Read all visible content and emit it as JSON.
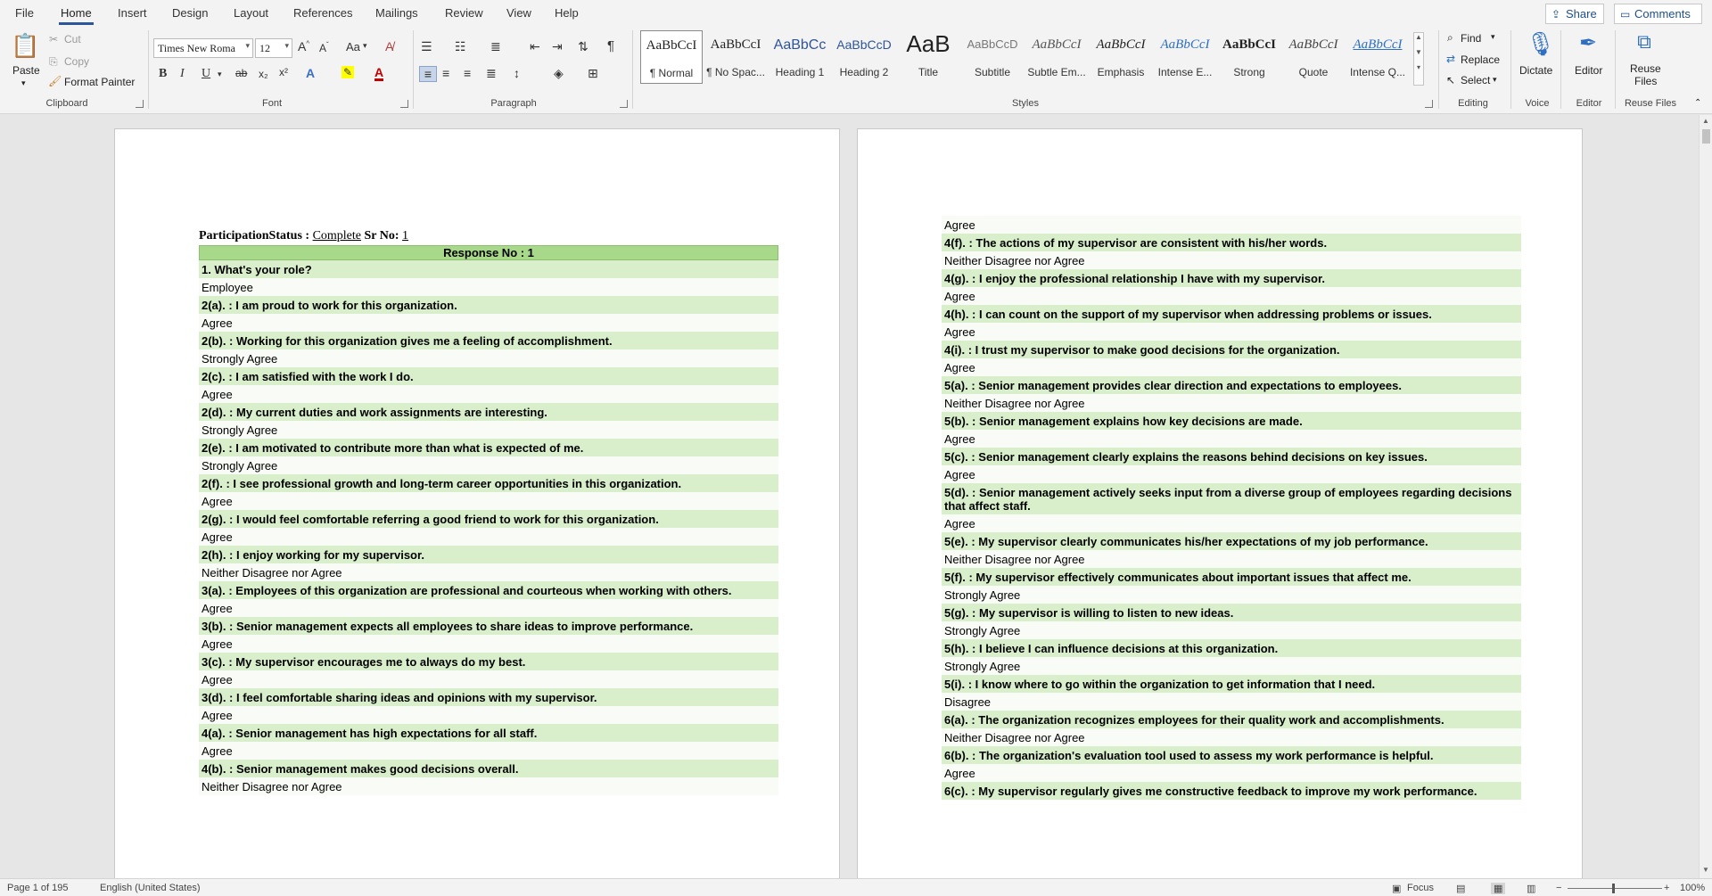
{
  "menu": {
    "tabs": [
      "File",
      "Home",
      "Insert",
      "Design",
      "Layout",
      "References",
      "Mailings",
      "Review",
      "View",
      "Help"
    ],
    "active_tab": "Home",
    "share_label": "Share",
    "comments_label": "Comments"
  },
  "ribbon": {
    "clipboard": {
      "paste": "Paste",
      "cut": "Cut",
      "copy": "Copy",
      "format_painter": "Format Painter",
      "group": "Clipboard"
    },
    "font": {
      "name": "Times New Roma",
      "size": "12",
      "case_label": "Aa",
      "group": "Font"
    },
    "paragraph": {
      "group": "Paragraph"
    },
    "styles": {
      "group": "Styles",
      "items": [
        {
          "sample": "AaBbCcI",
          "name": "¶ Normal"
        },
        {
          "sample": "AaBbCcI",
          "name": "¶ No Spac..."
        },
        {
          "sample": "AaBbCc",
          "name": "Heading 1"
        },
        {
          "sample": "AaBbCcD",
          "name": "Heading 2"
        },
        {
          "sample": "AaB",
          "name": "Title"
        },
        {
          "sample": "AaBbCcD",
          "name": "Subtitle"
        },
        {
          "sample": "AaBbCcI",
          "name": "Subtle Em..."
        },
        {
          "sample": "AaBbCcI",
          "name": "Emphasis"
        },
        {
          "sample": "AaBbCcI",
          "name": "Intense E..."
        },
        {
          "sample": "AaBbCcI",
          "name": "Strong"
        },
        {
          "sample": "AaBbCcI",
          "name": "Quote"
        },
        {
          "sample": "AaBbCcI",
          "name": "Intense Q..."
        }
      ]
    },
    "editing": {
      "group": "Editing",
      "find": "Find",
      "replace": "Replace",
      "select": "Select"
    },
    "voice": {
      "group": "Voice",
      "dictate": "Dictate"
    },
    "editor": {
      "group": "Editor",
      "editor": "Editor"
    },
    "reuse": {
      "group": "Reuse Files",
      "line1": "Reuse",
      "line2": "Files"
    }
  },
  "document": {
    "header": {
      "label1": "ParticipationStatus :",
      "status": "Complete",
      "label2": "Sr No:",
      "sr_no": "1"
    },
    "response_title": "Response No : 1",
    "page1_rows": [
      {
        "t": "q",
        "text": "1. What's your role?"
      },
      {
        "t": "a",
        "text": "Employee"
      },
      {
        "t": "q",
        "text": "2(a). : I am proud to work for this organization."
      },
      {
        "t": "a",
        "text": "Agree"
      },
      {
        "t": "q",
        "text": "2(b). : Working for this organization gives me a feeling of accomplishment."
      },
      {
        "t": "a",
        "text": "Strongly Agree"
      },
      {
        "t": "q",
        "text": "2(c). : I am satisfied with the work I do."
      },
      {
        "t": "a",
        "text": "Agree"
      },
      {
        "t": "q",
        "text": "2(d). : My current duties and work assignments are interesting."
      },
      {
        "t": "a",
        "text": "Strongly Agree"
      },
      {
        "t": "q",
        "text": "2(e). : I am motivated to contribute more than what is expected of me."
      },
      {
        "t": "a",
        "text": "Strongly Agree"
      },
      {
        "t": "q",
        "text": "2(f). : I see professional growth and long-term career opportunities in this organization."
      },
      {
        "t": "a",
        "text": "Agree"
      },
      {
        "t": "q",
        "text": "2(g). : I would feel comfortable referring a good friend to work for this organization."
      },
      {
        "t": "a",
        "text": "Agree"
      },
      {
        "t": "q",
        "text": "2(h). : I enjoy working for my supervisor."
      },
      {
        "t": "a",
        "text": "Neither Disagree nor Agree"
      },
      {
        "t": "q",
        "text": "3(a). : Employees of this organization are professional and courteous when working with others."
      },
      {
        "t": "a",
        "text": "Agree"
      },
      {
        "t": "q",
        "text": "3(b). : Senior management expects all employees to share ideas to improve performance."
      },
      {
        "t": "a",
        "text": "Agree"
      },
      {
        "t": "q",
        "text": "3(c). : My supervisor encourages me to always do my best."
      },
      {
        "t": "a",
        "text": "Agree"
      },
      {
        "t": "q",
        "text": "3(d). : I feel comfortable sharing ideas and opinions with my supervisor."
      },
      {
        "t": "a",
        "text": "Agree"
      },
      {
        "t": "q",
        "text": "4(a). : Senior management has high expectations for all staff."
      },
      {
        "t": "a",
        "text": "Agree"
      },
      {
        "t": "q",
        "text": "4(b). : Senior management makes good decisions overall."
      },
      {
        "t": "a",
        "text": "Neither Disagree nor Agree"
      }
    ],
    "page2_rows": [
      {
        "t": "a",
        "text": "Agree"
      },
      {
        "t": "q",
        "text": "4(f). : The actions of my supervisor are consistent with his/her words."
      },
      {
        "t": "a",
        "text": "Neither Disagree nor Agree"
      },
      {
        "t": "q",
        "text": "4(g). : I enjoy the professional relationship I have with my supervisor."
      },
      {
        "t": "a",
        "text": "Agree"
      },
      {
        "t": "q",
        "text": "4(h). : I can count on the support of my supervisor when addressing problems or issues."
      },
      {
        "t": "a",
        "text": "Agree"
      },
      {
        "t": "q",
        "text": "4(i). : I trust my supervisor to make good decisions for the organization."
      },
      {
        "t": "a",
        "text": "Agree"
      },
      {
        "t": "q",
        "text": "5(a). : Senior management provides clear direction and expectations to employees."
      },
      {
        "t": "a",
        "text": "Neither Disagree nor Agree"
      },
      {
        "t": "q",
        "text": "5(b). : Senior management explains how key decisions are made."
      },
      {
        "t": "a",
        "text": "Agree"
      },
      {
        "t": "q",
        "text": "5(c). : Senior management clearly explains the reasons behind decisions on key issues."
      },
      {
        "t": "a",
        "text": "Agree"
      },
      {
        "t": "q",
        "text": "5(d). : Senior management actively seeks input from a diverse group of employees regarding decisions that affect staff."
      },
      {
        "t": "a",
        "text": "Agree"
      },
      {
        "t": "q",
        "text": "5(e). : My supervisor clearly communicates his/her expectations of my job performance."
      },
      {
        "t": "a",
        "text": "Neither Disagree nor Agree"
      },
      {
        "t": "q",
        "text": "5(f). : My supervisor effectively communicates about important issues that affect me."
      },
      {
        "t": "a",
        "text": "Strongly Agree"
      },
      {
        "t": "q",
        "text": "5(g). : My supervisor is willing to listen to new ideas."
      },
      {
        "t": "a",
        "text": "Strongly Agree"
      },
      {
        "t": "q",
        "text": "5(h). : I believe I can influence decisions at this organization."
      },
      {
        "t": "a",
        "text": "Strongly Agree"
      },
      {
        "t": "q",
        "text": "5(i). : I know where to go within the organization to get information that I need."
      },
      {
        "t": "a",
        "text": "Disagree"
      },
      {
        "t": "q",
        "text": "6(a). : The organization recognizes employees for their quality work and accomplishments."
      },
      {
        "t": "a",
        "text": "Neither Disagree nor Agree"
      },
      {
        "t": "q",
        "text": "6(b). : The organization's evaluation tool used to assess my work performance is helpful."
      },
      {
        "t": "a",
        "text": "Agree"
      },
      {
        "t": "q",
        "text": "6(c). : My supervisor regularly gives me constructive feedback to improve my work performance."
      }
    ]
  },
  "status": {
    "page": "Page 1 of 195",
    "language": "English (United States)",
    "focus": "Focus",
    "zoom": "100%"
  },
  "colors": {
    "accent": "#2b579a",
    "question_bg": "#d9efcb",
    "title_bg": "#a8d88a"
  }
}
